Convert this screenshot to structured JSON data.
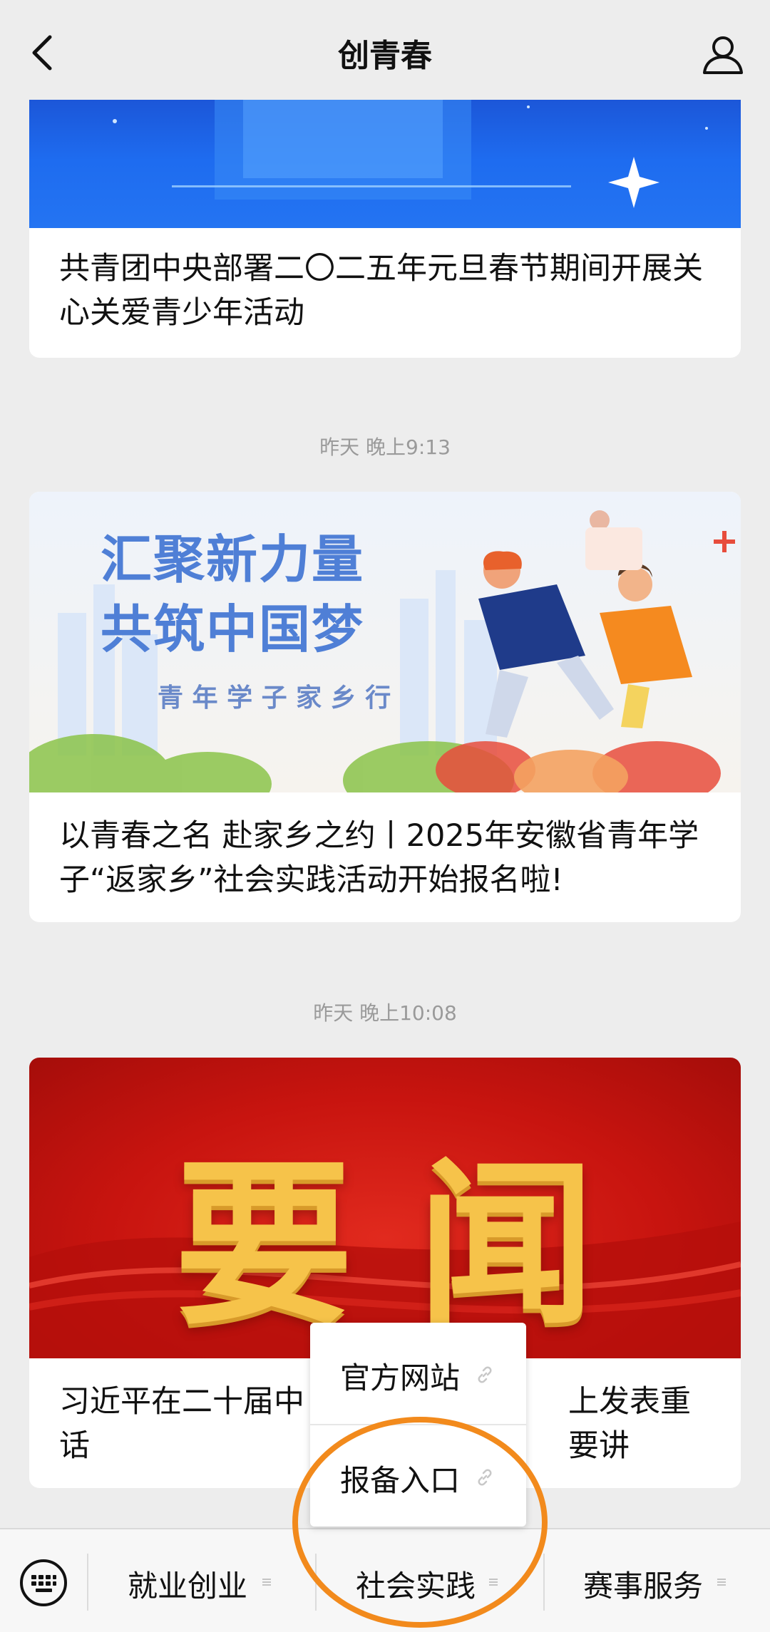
{
  "header": {
    "title": "创青春",
    "back_icon": "back-arrow-icon",
    "profile_icon": "person-icon"
  },
  "articles": [
    {
      "caption": "共青团中央部署二〇二五年元旦春节期间开展关心关爱青少年活动"
    },
    {
      "timestamp": "昨天 晚上9:13",
      "banner_line1": "汇聚新力量",
      "banner_line2": "共筑中国梦",
      "banner_line3": "青 年 学 子 家 乡 行",
      "caption": "以青春之名 赴家乡之约丨2025年安徽省青年学子“返家乡”社会实践活动开始报名啦!"
    },
    {
      "timestamp": "昨天 晚上10:08",
      "banner_text": "要闻",
      "caption_left": "习近平在二十届中",
      "caption_right": "上发表重要讲",
      "caption_line2": "话"
    }
  ],
  "popup": {
    "items": [
      {
        "label": "官方网站",
        "icon": "link-icon"
      },
      {
        "label": "报备入口",
        "icon": "link-icon"
      }
    ]
  },
  "bottom_menu": {
    "keyboard_icon": "keyboard-icon",
    "items": [
      {
        "label": "就业创业"
      },
      {
        "label": "社会实践"
      },
      {
        "label": "赛事服务"
      }
    ]
  },
  "colors": {
    "highlight": "#f28a1c",
    "news_red": "#c8140f",
    "banner_blue": "#1e6cf0"
  }
}
